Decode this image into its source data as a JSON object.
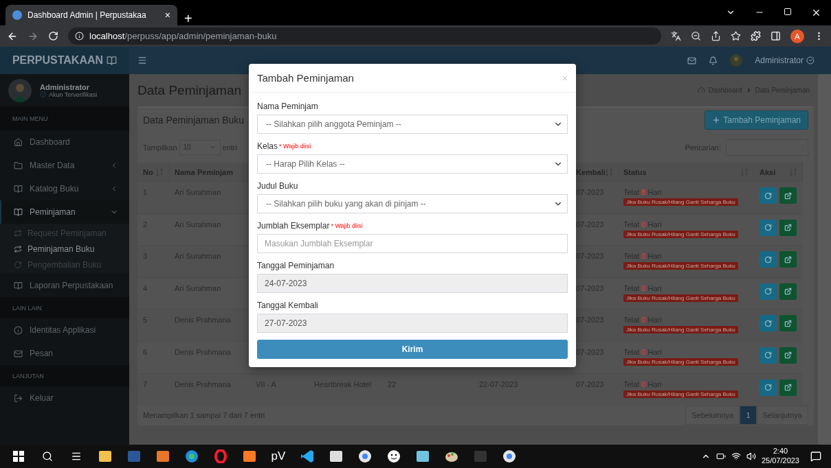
{
  "browser": {
    "tab_title": "Dashboard Admin | Perpustakaa",
    "tab_close": "×",
    "new_tab": "+",
    "url_host": "localhost",
    "url_path": "/perpuss/app/admin/peminjaman-buku",
    "profile_initial": "A"
  },
  "navbar": {
    "brand": "PERPUSTAKAAN",
    "user": "Administrator"
  },
  "sidebar": {
    "user_name": "Administrator",
    "user_status": "Akun Terverifikasi",
    "sections": [
      {
        "header": "MAIN MENU",
        "items": [
          {
            "label": "Dashboard",
            "selected": false
          },
          {
            "label": "Master Data",
            "selected": false,
            "expanded": false
          },
          {
            "label": "Katalog Buku",
            "selected": false,
            "expanded": false
          },
          {
            "label": "Peminjaman",
            "selected": true,
            "expanded": true,
            "children": [
              {
                "label": "Request Peminjaman",
                "selected": false
              },
              {
                "label": "Peminjaman Buku",
                "selected": true
              },
              {
                "label": "Pengembalian Buku",
                "selected": false
              }
            ]
          },
          {
            "label": "Laporan Perpustakaan",
            "selected": false
          }
        ]
      },
      {
        "header": "LAIN LAIN",
        "items": [
          {
            "label": "Identitas Applikasi",
            "selected": false
          },
          {
            "label": "Pesan",
            "selected": false
          }
        ]
      },
      {
        "header": "LANJUTAN",
        "items": [
          {
            "label": "Keluar",
            "selected": false
          }
        ]
      }
    ]
  },
  "page": {
    "title": "Data Peminjaman",
    "breadcrumb": [
      "Dashboard",
      "Data Peminjaman"
    ]
  },
  "card": {
    "title": "Data Peminjaman Buku",
    "add_button": "Tambah Peminjaman",
    "length_label": "Tampilkan",
    "length_value": "10",
    "length_suffix": "entri",
    "search_label": "Pencarian:",
    "columns": [
      "No",
      "Nama Peminjam",
      "Kembali",
      "Status",
      "Aksi"
    ],
    "rows": [
      {
        "no": "1",
        "name": "Ari Surahman",
        "kembali": "07-2023",
        "status_prefix": "Telat",
        "late_days": "8",
        "status_suffix": "Hari",
        "note": "Jika Buku Rusak/Hilang Ganti Seharga Buku"
      },
      {
        "no": "2",
        "name": "Ari Surahman",
        "kembali": "07-2023",
        "status_prefix": "Telat",
        "late_days": "0",
        "status_suffix": "Hari",
        "note": "Jika Buku Rusak/Hilang Ganti Seharga Buku"
      },
      {
        "no": "3",
        "name": "Ari Surahman",
        "kembali": "07-2023",
        "status_prefix": "Telat",
        "late_days": "0",
        "status_suffix": "Hari",
        "note": "Jika Buku Rusak/Hilang Ganti Seharga Buku"
      },
      {
        "no": "4",
        "name": "Ari Surahman",
        "kembali": "07-2023",
        "status_prefix": "Telat",
        "late_days": "0",
        "status_suffix": "Hari",
        "note": "Jika Buku Rusak/Hilang Ganti Seharga Buku"
      },
      {
        "no": "5",
        "name": "Denis Prahmana",
        "kembali": "07-2023",
        "status_prefix": "Telat",
        "late_days": "0",
        "status_suffix": "Hari",
        "note": "Jika Buku Rusak/Hilang Ganti Seharga Buku"
      },
      {
        "no": "6",
        "name": "Denis Prahmana",
        "kembali": "07-2023",
        "status_prefix": "Telat",
        "late_days": "0",
        "status_suffix": "Hari",
        "note": "Jika Buku Rusak/Hilang Ganti Seharga Buku"
      },
      {
        "no": "7",
        "name": "Denis Prahmana",
        "kembali": "07-2023",
        "status_prefix": "Telat",
        "late_days": "0",
        "status_suffix": "Hari",
        "note": "Jika Buku Rusak/Hilang Ganti Seharga Buku",
        "covered_cells": [
          "VII - A",
          "Heartbreak Hotel",
          "22",
          "22-07-2023"
        ]
      }
    ],
    "info": "Menampilkan 1 sampai 7 dari 7 entri",
    "pagination": [
      {
        "label": "Sebelumnya",
        "selected": false
      },
      {
        "label": "1",
        "selected": true
      },
      {
        "label": "Selanjutnya",
        "selected": false
      }
    ]
  },
  "modal": {
    "title": "Tambah Peminjaman",
    "close": "×",
    "fields": [
      {
        "kind": "select",
        "label": "Nama Peminjam",
        "placeholder": "-- Silahkan pilih anggota Peminjam --"
      },
      {
        "kind": "select",
        "label": "Kelas",
        "required_note": "* Wajib diisi",
        "placeholder": "-- Harap Pilih Kelas --"
      },
      {
        "kind": "select",
        "label": "Judul Buku",
        "placeholder": "-- Silahkan pilih buku yang akan di pinjam --"
      },
      {
        "kind": "input",
        "label": "Jumblah Eksemplar",
        "required_note": "* Wajib diisi",
        "placeholder": "Masukan Jumblah Eksemplar"
      },
      {
        "kind": "readonly",
        "label": "Tanggal Peminjaman",
        "value": "24-07-2023"
      },
      {
        "kind": "readonly",
        "label": "Tanggal Kembali",
        "value": "27-07-2023"
      }
    ],
    "submit": "Kirim"
  },
  "taskbar": {
    "text_app": "pV",
    "time": "2:40",
    "date": "25/07/2023"
  }
}
